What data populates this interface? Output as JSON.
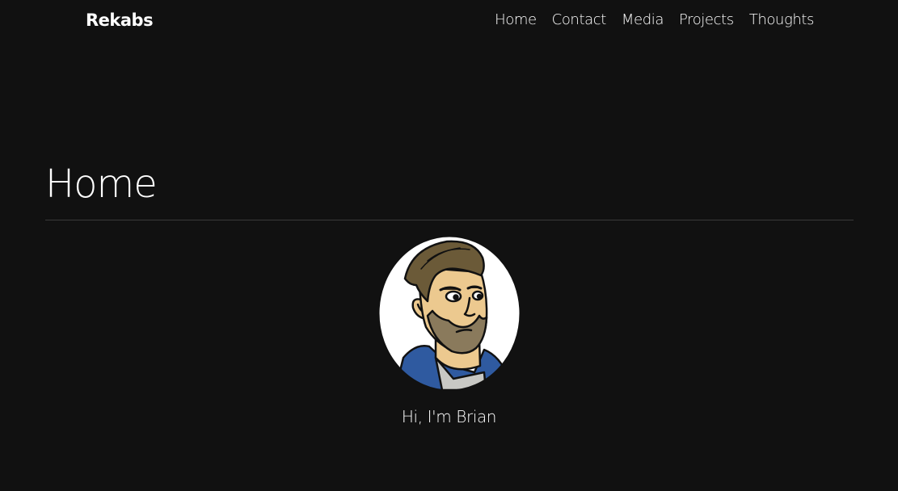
{
  "header": {
    "brand": "Rekabs",
    "nav": [
      {
        "label": "Home"
      },
      {
        "label": "Contact"
      },
      {
        "label": "Media"
      },
      {
        "label": "Projects"
      },
      {
        "label": "Thoughts"
      }
    ]
  },
  "main": {
    "title": "Home",
    "avatar_icon": "cartoon-portrait-avatar",
    "greeting": "Hi, I'm Brian"
  },
  "colors": {
    "background": "#111111",
    "text": "#ffffff",
    "divider": "#3a3a3a"
  }
}
